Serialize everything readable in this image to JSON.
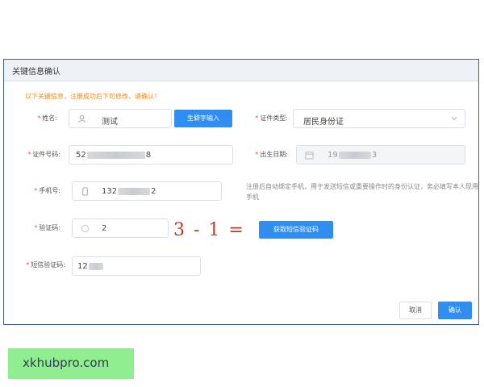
{
  "dialog": {
    "title": "关键信息确认",
    "notice": "以下关键信息，注册成功后下可修改，请确认！",
    "fields": {
      "name": {
        "label": "姓名:",
        "value": "测试",
        "button": "生僻字输入"
      },
      "id_type": {
        "label": "证件类型:",
        "value": "居民身份证"
      },
      "id_number": {
        "label": "证件号码:",
        "value_prefix": "52",
        "value_suffix": "8"
      },
      "birth_date": {
        "label": "出生日期:",
        "value_prefix": "19",
        "value_suffix": "3"
      },
      "phone": {
        "label": "手机号:",
        "value_prefix": "132",
        "value_suffix": "2"
      },
      "captcha": {
        "label": "验证码:",
        "value": "2",
        "image_text": "3 - 1 =",
        "button": "获取短信验证码"
      },
      "sms_code": {
        "label": "短信验证码:",
        "value_prefix": "12"
      }
    },
    "phone_hint": "注册后自动绑定手机，用于发送短信或重要操作时的身份认证，务必填写本人现用手机",
    "footer": {
      "cancel": "取消",
      "confirm": "确认"
    }
  },
  "watermark": {
    "text": "xkhubpro.com"
  },
  "colors": {
    "primary": "#2f8ef0",
    "warning": "#f08a1c",
    "required": "#f04b4b",
    "watermark_bg": "#90ee90"
  }
}
